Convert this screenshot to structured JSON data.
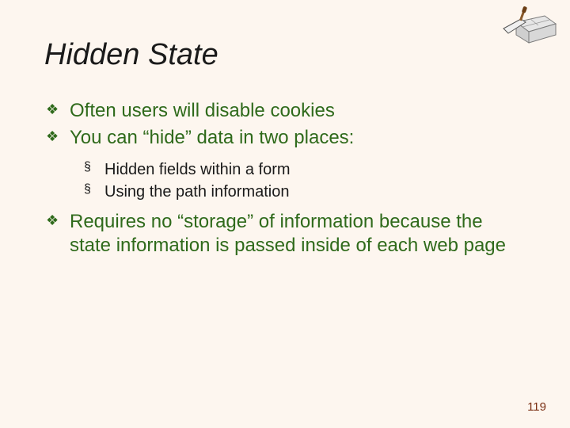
{
  "slide": {
    "title": "Hidden State",
    "page_number": "119"
  },
  "bullets": {
    "b0": "Often users will disable cookies",
    "b1": "You can “hide” data in two places:",
    "b1_0": "Hidden fields within a form",
    "b1_1": "Using the path information",
    "b2": "Requires no “storage” of information because the state information is passed inside of each web page"
  }
}
